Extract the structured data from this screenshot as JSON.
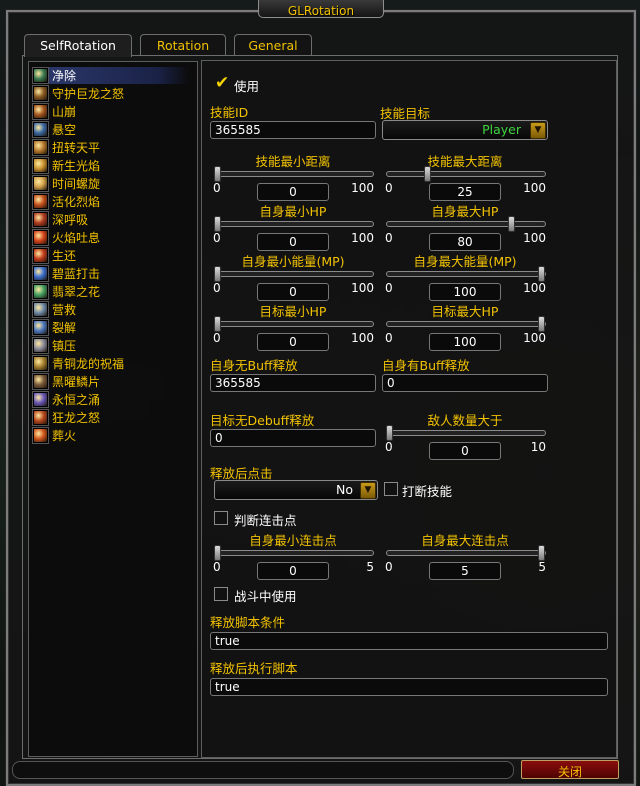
{
  "window": {
    "title": "GLRotation"
  },
  "tabs": [
    {
      "label": "SelfRotation",
      "active": true
    },
    {
      "label": "Rotation",
      "active": false
    },
    {
      "label": "General",
      "active": false
    }
  ],
  "spell_list": {
    "selected_index": 0,
    "items": [
      {
        "label": "净除",
        "icon_color": "#3a7a52"
      },
      {
        "label": "守护巨龙之怒",
        "icon_color": "#8a5a22"
      },
      {
        "label": "山崩",
        "icon_color": "#a2551e"
      },
      {
        "label": "悬空",
        "icon_color": "#3a6aa5"
      },
      {
        "label": "扭转天平",
        "icon_color": "#b5782e"
      },
      {
        "label": "新生光焰",
        "icon_color": "#c9922f"
      },
      {
        "label": "时间螺旋",
        "icon_color": "#d1a04a"
      },
      {
        "label": "活化烈焰",
        "icon_color": "#c4501d"
      },
      {
        "label": "深呼吸",
        "icon_color": "#b23c22"
      },
      {
        "label": "火焰吐息",
        "icon_color": "#d6421a"
      },
      {
        "label": "生还",
        "icon_color": "#c23b1b"
      },
      {
        "label": "碧蓝打击",
        "icon_color": "#3b6fd0"
      },
      {
        "label": "翡翠之花",
        "icon_color": "#45a062"
      },
      {
        "label": "营救",
        "icon_color": "#6d8aa8"
      },
      {
        "label": "裂解",
        "icon_color": "#4c78bf"
      },
      {
        "label": "镇压",
        "icon_color": "#8a8a9a"
      },
      {
        "label": "青铜龙的祝福",
        "icon_color": "#a7812e"
      },
      {
        "label": "黑曜鳞片",
        "icon_color": "#7a5a3a"
      },
      {
        "label": "永恒之涌",
        "icon_color": "#6a58b8"
      },
      {
        "label": "狂龙之怒",
        "icon_color": "#b8471e"
      },
      {
        "label": "葬火",
        "icon_color": "#d0561c"
      }
    ]
  },
  "form": {
    "use_checkbox": {
      "label": "使用",
      "checked": true
    },
    "skill_id": {
      "label": "技能ID",
      "value": "365585"
    },
    "skill_target": {
      "label": "技能目标",
      "value": "Player"
    },
    "min_distance": {
      "label": "技能最小距离",
      "value": "0",
      "min": "0",
      "max": "100",
      "fraction": 0.0
    },
    "max_distance": {
      "label": "技能最大距离",
      "value": "25",
      "min": "0",
      "max": "100",
      "fraction": 0.25
    },
    "self_min_hp": {
      "label": "自身最小HP",
      "value": "0",
      "min": "0",
      "max": "100",
      "fraction": 0.0
    },
    "self_max_hp": {
      "label": "自身最大HP",
      "value": "80",
      "min": "0",
      "max": "100",
      "fraction": 0.8
    },
    "self_min_power": {
      "label": "自身最小能量(MP)",
      "value": "0",
      "min": "0",
      "max": "100",
      "fraction": 0.0
    },
    "self_max_power": {
      "label": "自身最大能量(MP)",
      "value": "100",
      "min": "0",
      "max": "100",
      "fraction": 1.0
    },
    "target_min_hp": {
      "label": "目标最小HP",
      "value": "0",
      "min": "0",
      "max": "100",
      "fraction": 0.0
    },
    "target_max_hp": {
      "label": "目标最大HP",
      "value": "100",
      "min": "0",
      "max": "100",
      "fraction": 1.0
    },
    "self_no_buff": {
      "label": "自身无Buff释放",
      "value": "365585"
    },
    "self_has_buff": {
      "label": "自身有Buff释放",
      "value": "0"
    },
    "target_no_debuff": {
      "label": "目标无Debuff释放",
      "value": "0"
    },
    "enemy_count": {
      "label": "敌人数量大于",
      "value": "0",
      "min": "0",
      "max": "10",
      "fraction": 0.0
    },
    "after_cast_click": {
      "label": "释放后点击",
      "value": "No"
    },
    "interrupt_checkbox": {
      "label": "打断技能",
      "checked": false
    },
    "combo_checkbox": {
      "label": "判断连击点",
      "checked": false
    },
    "self_min_combo": {
      "label": "自身最小连击点",
      "value": "0",
      "min": "0",
      "max": "5",
      "fraction": 0.0
    },
    "self_max_combo": {
      "label": "自身最大连击点",
      "value": "5",
      "min": "0",
      "max": "5",
      "fraction": 1.0
    },
    "combat_checkbox": {
      "label": "战斗中使用",
      "checked": false
    },
    "cast_condition": {
      "label": "释放脚本条件",
      "value": "true"
    },
    "after_script": {
      "label": "释放后执行脚本",
      "value": "true"
    }
  },
  "close_button": {
    "label": "关闭"
  },
  "colors": {
    "gold": "#f2c200",
    "white": "#ffffff",
    "selected_row": "#2d3a6e",
    "close_red": "#8a0d0d"
  }
}
